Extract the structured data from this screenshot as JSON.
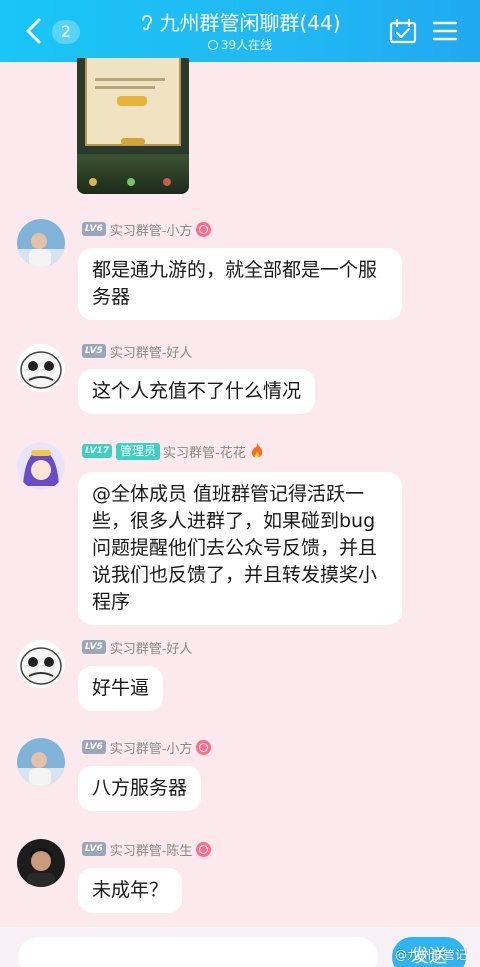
{
  "header": {
    "unread_count": "2",
    "title": "九州群管闲聊群(44)",
    "online": "39人在线",
    "icons": [
      "back-arrow-icon",
      "ear-icon",
      "calendar-check-icon",
      "hamburger-menu-icon"
    ]
  },
  "messages": [
    {
      "level": "LV6",
      "role": "",
      "name": "实习群管-小方",
      "badge": "pink-badge",
      "text": "都是通九游的，就全部都是一个服务器"
    },
    {
      "level": "LV5",
      "role": "",
      "name": "实习群管-好人",
      "badge": "",
      "text": "这个人充值不了什么情况"
    },
    {
      "level": "LV17",
      "role": "管理员",
      "name": "实习群管-花花",
      "badge": "fire",
      "text": "@全体成员 值班群管记得活跃一些，很多人进群了，如果碰到bug问题提醒他们去公众号反馈，并且说我们也反馈了，并且转发摸奖小程序"
    },
    {
      "level": "LV5",
      "role": "",
      "name": "实习群管-好人",
      "badge": "",
      "text": "好牛逼"
    },
    {
      "level": "LV6",
      "role": "",
      "name": "实习群管-小方",
      "badge": "pink-badge",
      "text": "八方服务器"
    },
    {
      "level": "LV6",
      "role": "",
      "name": "实习群管-陈生",
      "badge": "pink-badge",
      "text": "未成年？"
    }
  ],
  "input": {
    "send_label": "发送"
  },
  "watermark": "@九州群管记",
  "colors": {
    "header": "#21b8f3",
    "background": "#fbe9ee",
    "bubble": "#ffffff",
    "admin": "#3bd1c3"
  }
}
